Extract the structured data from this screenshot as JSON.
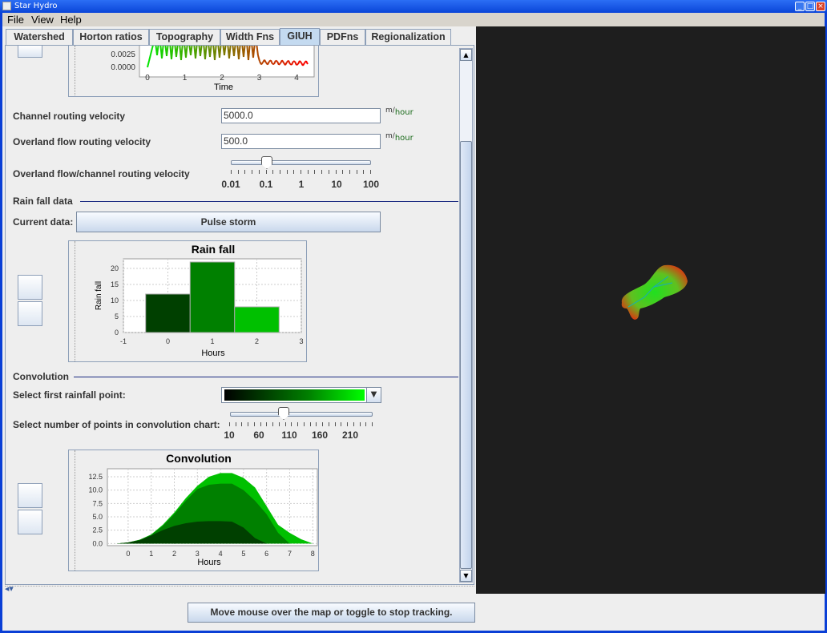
{
  "window": {
    "title": "Star Hydro"
  },
  "menu": [
    "File",
    "View",
    "Help"
  ],
  "tabs": [
    {
      "label": "Watershed"
    },
    {
      "label": "Horton ratios"
    },
    {
      "label": "Topography"
    },
    {
      "label": "Width Fns"
    },
    {
      "label": "GIUH",
      "active": true
    },
    {
      "label": "PDFns"
    },
    {
      "label": "Regionalization"
    }
  ],
  "form": {
    "channel_velocity": {
      "label": "Channel routing velocity",
      "value": "5000.0",
      "unit_num": "m",
      "unit_den": "hour"
    },
    "overland_velocity": {
      "label": "Overland flow routing velocity",
      "value": "500.0",
      "unit_num": "m",
      "unit_den": "hour"
    },
    "ratio_slider": {
      "label": "Overland flow/channel routing velocity",
      "tick_labels": [
        "0.01",
        "0.1",
        "1",
        "10",
        "100"
      ],
      "value": 0.1
    },
    "rainfall_section": "Rain fall data",
    "current_data_label": "Current data:",
    "current_data_button": "Pulse storm",
    "convolution_section": "Convolution",
    "first_point_label": "Select first rainfall point:",
    "points_slider": {
      "label": "Select number of points in convolution chart:",
      "tick_labels": [
        "10",
        "60",
        "110",
        "160",
        "210"
      ],
      "value": 100
    }
  },
  "status": {
    "button": "Move mouse over the map or toggle to stop tracking."
  },
  "colors": {
    "dark_green": "#004000",
    "mid_green": "#008000",
    "light_green": "#00c000",
    "map_bg": "#1e1e1e"
  },
  "chart_data": [
    {
      "type": "line",
      "xlabel": "Time",
      "yticks": [
        "0.0025",
        "0.0000"
      ],
      "xticks": [
        "0",
        "1",
        "2",
        "3",
        "4"
      ],
      "partially_visible": true
    },
    {
      "type": "bar",
      "title": "Rain fall",
      "xlabel": "Hours",
      "ylabel": "Rain fall",
      "categories": [
        0,
        1,
        2
      ],
      "values": [
        12,
        22,
        8
      ],
      "xlim": [
        -1,
        3
      ],
      "ylim": [
        0,
        23
      ],
      "xticks": [
        "-1",
        "0",
        "1",
        "2",
        "3"
      ],
      "yticks": [
        "0",
        "5",
        "10",
        "15",
        "20"
      ],
      "grid": true
    },
    {
      "type": "area",
      "title": "Convolution",
      "xlabel": "Hours",
      "stacked": true,
      "xlim": [
        -0.9,
        8.2
      ],
      "ylim": [
        -0.4,
        14
      ],
      "xticks": [
        "0",
        "1",
        "2",
        "3",
        "4",
        "5",
        "6",
        "7",
        "8"
      ],
      "yticks": [
        "0.0",
        "2.5",
        "5.0",
        "7.5",
        "10.0",
        "12.5"
      ],
      "grid": true,
      "x": [
        -0.5,
        0,
        0.5,
        1,
        1.5,
        2,
        2.5,
        3,
        3.5,
        4,
        4.5,
        5,
        5.5,
        6,
        6.5,
        7,
        7.5,
        8
      ],
      "series": [
        {
          "color": "#00c000",
          "values": [
            0,
            0.2,
            0.7,
            1.7,
            3.5,
            5.8,
            8.5,
            10.8,
            12.5,
            13.2,
            13.2,
            12.3,
            10.5,
            7,
            3.5,
            2,
            0.8,
            0
          ]
        },
        {
          "color": "#008000",
          "values": [
            0,
            0.2,
            0.7,
            1.6,
            3.3,
            5.5,
            8,
            10.2,
            11,
            11.2,
            11.2,
            10,
            8,
            5.5,
            2,
            0,
            0,
            0
          ]
        },
        {
          "color": "#004000",
          "values": [
            0,
            0.2,
            0.6,
            1.5,
            2.5,
            3.3,
            3.8,
            4.1,
            4.2,
            4.2,
            4.1,
            3,
            1,
            0,
            0,
            0,
            0,
            0
          ]
        }
      ]
    }
  ]
}
